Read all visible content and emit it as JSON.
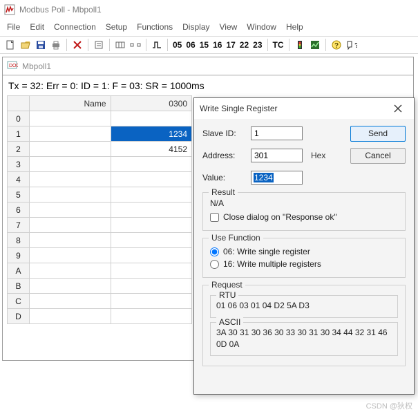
{
  "title": "Modbus Poll - Mbpoll1",
  "menu": [
    "File",
    "Edit",
    "Connection",
    "Setup",
    "Functions",
    "Display",
    "View",
    "Window",
    "Help"
  ],
  "toolbar_fc": [
    "05",
    "06",
    "15",
    "16",
    "17",
    "22",
    "23"
  ],
  "toolbar_tc": "TC",
  "child": {
    "title": "Mbpoll1",
    "stat_line": "Tx = 32: Err = 0: ID = 1: F = 03: SR = 1000ms",
    "col_name_header": "Name",
    "col_val_header": "0300",
    "rows": [
      {
        "hdr": "0",
        "name": "",
        "val": ""
      },
      {
        "hdr": "1",
        "name": "",
        "val": "1234",
        "selected": true
      },
      {
        "hdr": "2",
        "name": "",
        "val": "4152"
      },
      {
        "hdr": "3",
        "name": "",
        "val": ""
      },
      {
        "hdr": "4",
        "name": "",
        "val": ""
      },
      {
        "hdr": "5",
        "name": "",
        "val": ""
      },
      {
        "hdr": "6",
        "name": "",
        "val": ""
      },
      {
        "hdr": "7",
        "name": "",
        "val": ""
      },
      {
        "hdr": "8",
        "name": "",
        "val": ""
      },
      {
        "hdr": "9",
        "name": "",
        "val": ""
      },
      {
        "hdr": "A",
        "name": "",
        "val": ""
      },
      {
        "hdr": "B",
        "name": "",
        "val": ""
      },
      {
        "hdr": "C",
        "name": "",
        "val": ""
      },
      {
        "hdr": "D",
        "name": "",
        "val": ""
      }
    ]
  },
  "dialog": {
    "title": "Write Single Register",
    "labels": {
      "slave_id": "Slave ID:",
      "address": "Address:",
      "value": "Value:",
      "hex": "Hex"
    },
    "values": {
      "slave_id": "1",
      "address": "301",
      "value": "1234"
    },
    "buttons": {
      "send": "Send",
      "cancel": "Cancel"
    },
    "result": {
      "legend": "Result",
      "text": "N/A",
      "close_on_ok": "Close dialog on \"Response ok\"",
      "checked": false
    },
    "use_function": {
      "legend": "Use Function",
      "opt06": "06: Write single register",
      "opt16": "16: Write multiple registers",
      "selected": "06"
    },
    "request": {
      "legend": "Request",
      "rtu_legend": "RTU",
      "rtu": "01 06 03 01 04 D2 5A D3",
      "ascii_legend": "ASCII",
      "ascii": "3A 30 31 30 36 30 33 30 31 30 34 44 32 31 46 0D 0A"
    }
  },
  "watermark": "CSDN @狄权"
}
